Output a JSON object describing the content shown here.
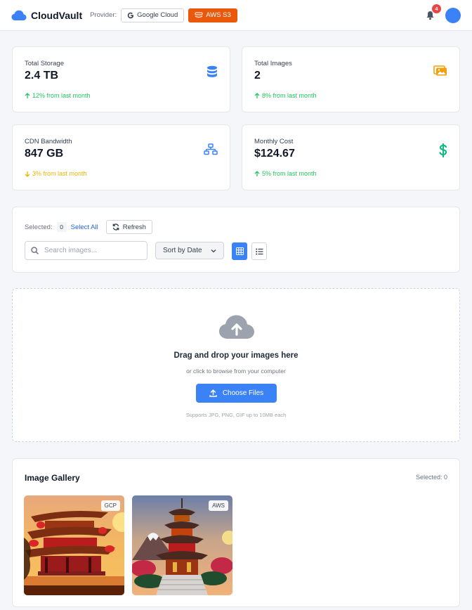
{
  "header": {
    "app_name": "CloudVault",
    "provider_label": "Provider:",
    "providers": [
      {
        "label": "Google Cloud",
        "active": false
      },
      {
        "label": "AWS S3",
        "active": true
      }
    ],
    "notification_count": "4"
  },
  "stats": [
    {
      "label": "Total Storage",
      "value": "2.4 TB",
      "trend": "12% from last month",
      "direction": "up",
      "icon": "database-icon",
      "color": "#3b82f6"
    },
    {
      "label": "Total Images",
      "value": "2",
      "trend": "8% from last month",
      "direction": "up",
      "icon": "images-icon",
      "color": "#f59e0b"
    },
    {
      "label": "CDN Bandwidth",
      "value": "847 GB",
      "trend": "3% from last month",
      "direction": "down",
      "icon": "network-icon",
      "color": "#3b82f6"
    },
    {
      "label": "Monthly Cost",
      "value": "$124.67",
      "trend": "5% from last month",
      "direction": "up",
      "icon": "dollar-icon",
      "color": "#10b981"
    }
  ],
  "toolbar": {
    "selected_label": "Selected:",
    "selected_count": "0",
    "select_all": "Select All",
    "refresh": "Refresh",
    "search_placeholder": "Search images...",
    "sort_value": "Sort by Date",
    "view_mode": "grid"
  },
  "upload": {
    "title": "Drag and drop your images here",
    "subtitle": "or click to browse from your computer",
    "button": "Choose Files",
    "note": "Supports JPG, PNG, GIF up to 10MB each"
  },
  "gallery": {
    "title": "Image Gallery",
    "selected": "Selected: 0",
    "images": [
      {
        "provider": "GCP"
      },
      {
        "provider": "AWS"
      }
    ]
  },
  "colors": {
    "accent": "#3b82f6",
    "aws": "#ea580c",
    "trend_up": "#22c55e",
    "trend_down": "#eab308"
  }
}
